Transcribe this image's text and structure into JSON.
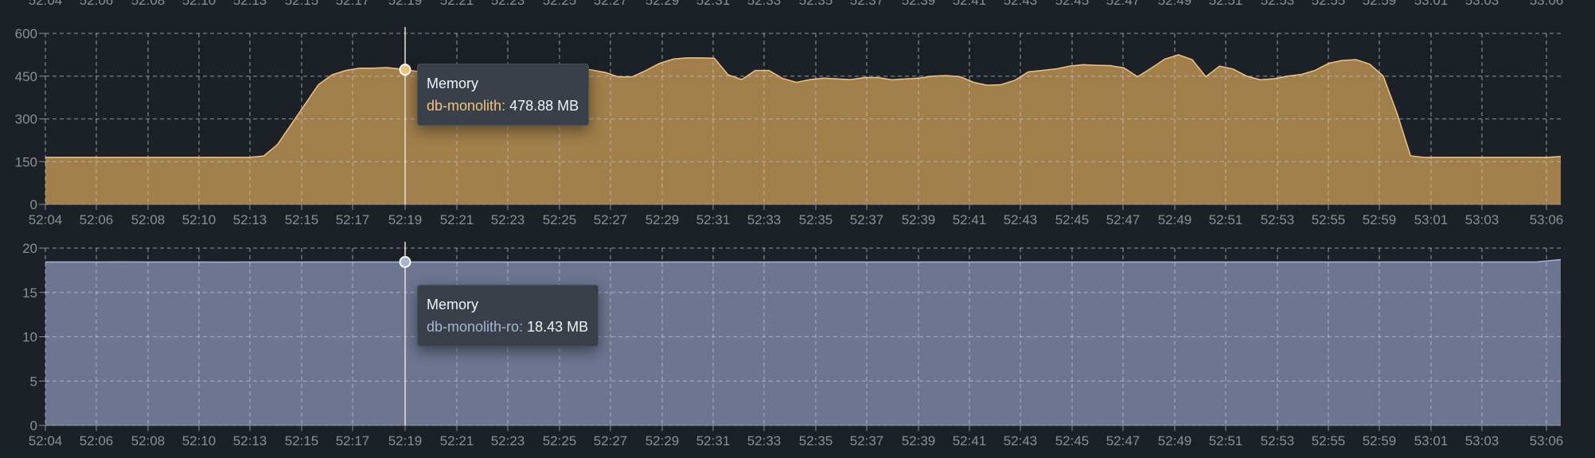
{
  "chart_data": [
    {
      "type": "area",
      "color": "#a07f4a",
      "line_color": "#f2c37a",
      "ylim": [
        0,
        600
      ],
      "yticks": [
        "0",
        "150",
        "300",
        "450",
        "600"
      ],
      "x_labels": [
        "52:04",
        "52:06",
        "52:08",
        "52:10",
        "52:13",
        "52:15",
        "52:17",
        "52:19",
        "52:21",
        "52:23",
        "52:25",
        "52:27",
        "52:29",
        "52:31",
        "52:33",
        "52:35",
        "52:37",
        "52:39",
        "52:41",
        "52:43",
        "52:45",
        "52:47",
        "52:49",
        "52:51",
        "52:53",
        "52:55",
        "52:59",
        "53:01",
        "53:03",
        "53:06"
      ],
      "series": [
        {
          "name": "db-monolith",
          "values": [
            165,
            165,
            165,
            165,
            165,
            165,
            165,
            165,
            165,
            165,
            165,
            165,
            165,
            165,
            165,
            165,
            170,
            210,
            280,
            350,
            420,
            455,
            470,
            478,
            478,
            480,
            475,
            468,
            462,
            460,
            462,
            465,
            470,
            475,
            478,
            483,
            488,
            487,
            482,
            478,
            472,
            463,
            447,
            448,
            470,
            495,
            510,
            514,
            514,
            513,
            455,
            438,
            470,
            470,
            442,
            428,
            438,
            443,
            440,
            438,
            445,
            445,
            437,
            440,
            443,
            450,
            452,
            448,
            428,
            418,
            420,
            435,
            465,
            470,
            475,
            485,
            490,
            488,
            487,
            479,
            448,
            478,
            510,
            525,
            508,
            448,
            485,
            475,
            450,
            437,
            441,
            450,
            456,
            470,
            495,
            505,
            508,
            492,
            450,
            320,
            170,
            165,
            165,
            165,
            165,
            165,
            165,
            165,
            165,
            165,
            165,
            168
          ]
        }
      ],
      "tooltip": {
        "title": "Memory",
        "series": "db-monolith",
        "value": "478.88 MB",
        "x": "52:19"
      }
    },
    {
      "type": "area",
      "color": "#6d7591",
      "line_color": "#aab2d4",
      "ylim": [
        0,
        20
      ],
      "yticks": [
        "0",
        "5",
        "10",
        "15",
        "20"
      ],
      "x_labels": [
        "52:04",
        "52:06",
        "52:08",
        "52:10",
        "52:13",
        "52:15",
        "52:17",
        "52:19",
        "52:21",
        "52:23",
        "52:25",
        "52:27",
        "52:29",
        "52:31",
        "52:33",
        "52:35",
        "52:37",
        "52:39",
        "52:41",
        "52:43",
        "52:45",
        "52:47",
        "52:49",
        "52:51",
        "52:53",
        "52:55",
        "52:59",
        "53:01",
        "53:03",
        "53:06"
      ],
      "series": [
        {
          "name": "db-monolith-ro",
          "values": [
            18.43,
            18.43,
            18.43,
            18.44,
            18.43,
            18.43,
            18.43,
            18.42,
            18.43,
            18.43,
            18.43,
            18.43,
            18.43,
            18.43,
            18.43,
            18.43,
            18.43,
            18.43,
            18.43,
            18.43,
            18.43,
            18.43,
            18.43,
            18.43,
            18.43,
            18.43,
            18.43,
            18.43,
            18.43,
            18.43,
            18.43,
            18.43,
            18.43,
            18.43,
            18.43,
            18.43,
            18.43,
            18.43,
            18.43,
            18.43,
            18.43,
            18.43,
            18.43,
            18.43,
            18.43,
            18.43,
            18.43,
            18.43,
            18.43,
            18.43,
            18.43,
            18.43,
            18.43,
            18.43,
            18.43,
            18.43,
            18.43,
            18.43,
            18.43,
            18.43,
            18.7
          ]
        }
      ],
      "tooltip": {
        "title": "Memory",
        "series": "db-monolith-ro",
        "value": "18.43 MB",
        "x": "52:19"
      }
    }
  ]
}
